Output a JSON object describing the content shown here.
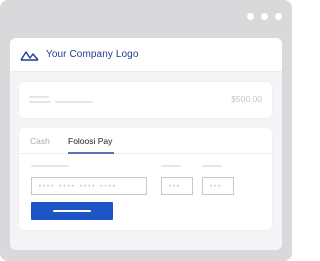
{
  "header": {
    "logo_text": "Your Company Logo"
  },
  "summary": {
    "price": "$500.00"
  },
  "payment": {
    "tabs": [
      {
        "label": "Cash",
        "active": false
      },
      {
        "label": "Foloosi Pay",
        "active": true
      }
    ],
    "card_number_placeholder": "•••• •••• •••• ••••",
    "expiry_placeholder": "•••",
    "cvc_placeholder": "•••"
  },
  "colors": {
    "brand": "#1f3d8f",
    "button": "#1e55c6",
    "tab_underline": "#5a73b7",
    "frame": "#d9d9dc"
  },
  "icons": {
    "logo": "mountain-logo-icon"
  }
}
